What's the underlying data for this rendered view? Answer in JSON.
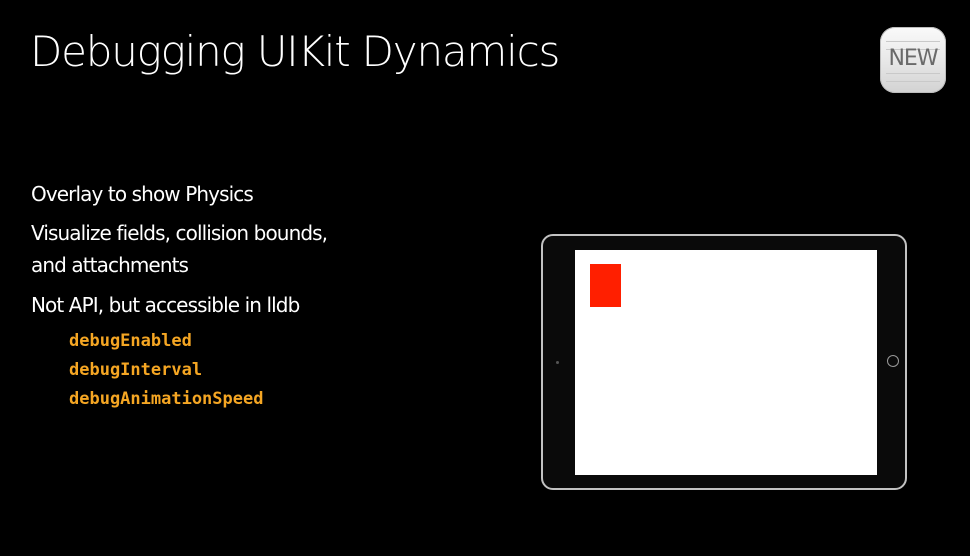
{
  "slide": {
    "title": "Debugging UIKit Dynamics",
    "badge": "NEW",
    "bullets": [
      "Overlay to show Physics",
      "Visualize fields, collision bounds,",
      "and attachments",
      "Not API, but accessible in lldb"
    ],
    "code_items": [
      "debugEnabled",
      "debugInterval",
      "debugAnimationSpeed"
    ],
    "colors": {
      "background": "#000000",
      "text": "#ffffff",
      "code": "#f5a623",
      "red_box": "#ff1f00",
      "screen": "#ffffff"
    },
    "device": {
      "type": "tablet",
      "camera_icon": "camera-dot-icon",
      "home_button_icon": "home-button-icon"
    }
  }
}
